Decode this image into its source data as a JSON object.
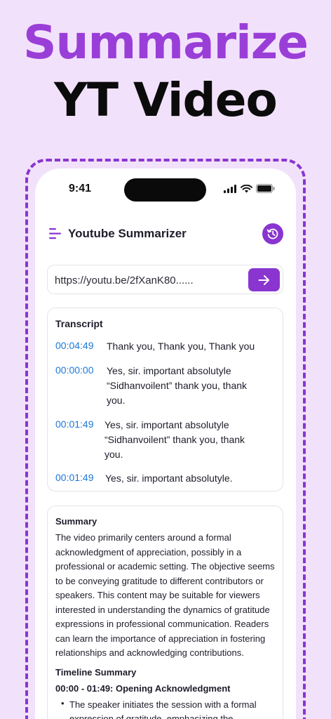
{
  "headline": {
    "line1": "Summarize",
    "line2": "YT Video"
  },
  "status_bar": {
    "time": "9:41"
  },
  "app": {
    "title": "Youtube Summarizer"
  },
  "url_bar": {
    "value": "https://youtu.be/2fXanK80......"
  },
  "transcript": {
    "title": "Transcript",
    "entries": [
      {
        "time": "00:04:49",
        "lines": [
          "Thank you, Thank you, Thank you"
        ]
      },
      {
        "time": "00:00:00",
        "lines": [
          "Yes, sir. important absolutyle",
          "“Sidhanvoilent” thank you, thank",
          "you."
        ]
      },
      {
        "time": "00:01:49",
        "lines": [
          "Yes, sir. important absolutyle",
          "“Sidhanvoilent” thank you, thank",
          "you."
        ]
      },
      {
        "time": "00:01:49",
        "lines": [
          "Yes, sir. important absolutyle."
        ]
      }
    ]
  },
  "summary": {
    "title": "Summary",
    "lines": [
      "The video primarily centers around a formal",
      "acknowledgment of appreciation, possibly in a",
      "professional or academic setting. The objective seems",
      "to be conveying gratitude to different contributors or",
      "speakers. This content may be suitable for viewers",
      "interested in understanding the dynamics of gratitude",
      "expressions in professional communication. Readers",
      "can learn the importance of appreciation in fostering",
      "relationships and acknowledging contributions."
    ],
    "timeline_title": "Timeline Summary",
    "section_title": "00:00 - 01:49: Opening Acknowledgment",
    "bullet_lines": [
      "The speaker initiates the session with a formal",
      "expression of gratitude, emphasizing the"
    ]
  },
  "colors": {
    "accent": "#8a35d0",
    "headline_purple": "#9a3ed8",
    "timestamp_blue": "#1c78d8",
    "background": "#f2e1fb"
  },
  "icons": {
    "menu": "menu-lines-icon",
    "history": "history-clock-icon",
    "go": "arrow-right-icon"
  }
}
